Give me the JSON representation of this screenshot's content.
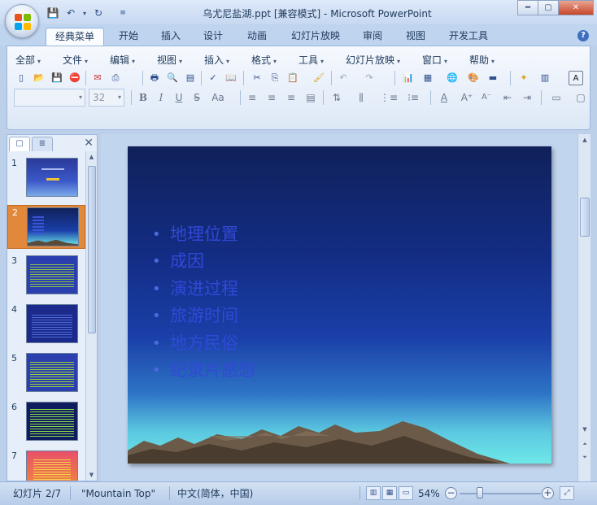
{
  "window": {
    "title": "乌尤尼盐湖.ppt [兼容模式] - Microsoft PowerPoint"
  },
  "ribbon_tabs": [
    {
      "label": "经典菜单",
      "active": true
    },
    {
      "label": "开始"
    },
    {
      "label": "插入"
    },
    {
      "label": "设计"
    },
    {
      "label": "动画"
    },
    {
      "label": "幻灯片放映"
    },
    {
      "label": "审阅"
    },
    {
      "label": "视图"
    },
    {
      "label": "开发工具"
    }
  ],
  "menu": [
    "全部",
    "文件",
    "编辑",
    "视图",
    "插入",
    "格式",
    "工具",
    "幻灯片放映",
    "窗口",
    "帮助"
  ],
  "font": {
    "name_value": "",
    "size_value": "32"
  },
  "slides_pane": {
    "tab_outline_glyph": "▢",
    "tab_slides_glyph": "≣",
    "close_glyph": "✕",
    "thumbnails": [
      {
        "number": "1"
      },
      {
        "number": "2",
        "selected": true
      },
      {
        "number": "3"
      },
      {
        "number": "4"
      },
      {
        "number": "5"
      },
      {
        "number": "6"
      },
      {
        "number": "7"
      }
    ]
  },
  "slide": {
    "bullets": [
      "地理位置",
      "成因",
      "演进过程",
      "旅游时间",
      "地方民俗",
      "纪录片感想"
    ]
  },
  "status": {
    "slide_indicator": "幻灯片 2/7",
    "theme": "\"Mountain Top\"",
    "language": "中文(简体，中国)",
    "zoom": "54%"
  },
  "colors": {
    "accent": "#1e395b",
    "bullet_text": "#3149d6",
    "selected_thumb": "#e2883a"
  }
}
